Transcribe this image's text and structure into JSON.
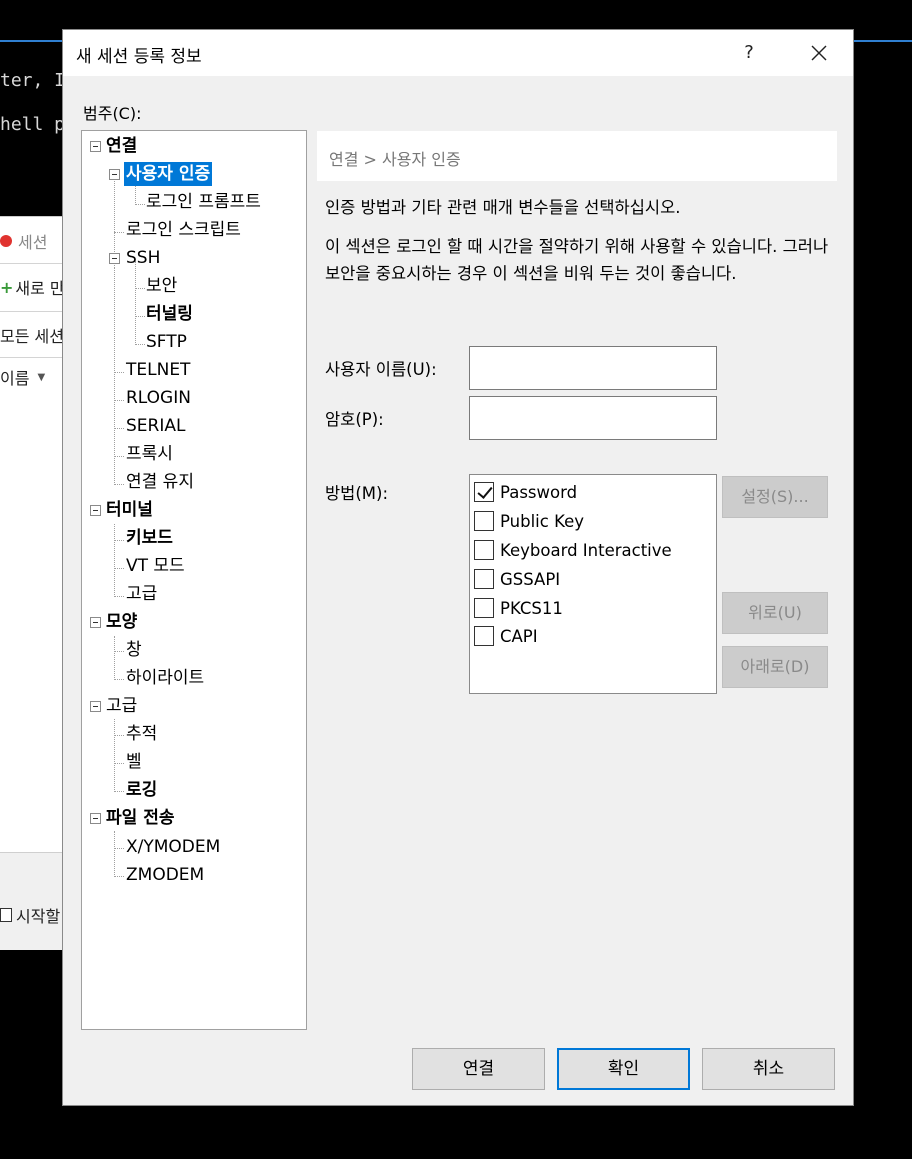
{
  "background": {
    "terminal_lines": [
      "ter, I",
      "hell p"
    ],
    "panel_items": [
      "세션",
      "새로 만",
      "모든 세션",
      "이름",
      "시작할"
    ]
  },
  "dialog": {
    "title": "새 세션 등록 정보",
    "help_label": "?",
    "category_label": "범주(C):",
    "tree": {
      "connection": "연결",
      "user_auth": "사용자 인증",
      "login_prompt": "로그인 프롬프트",
      "login_script": "로그인 스크립트",
      "ssh": "SSH",
      "security": "보안",
      "tunneling": "터널링",
      "sftp": "SFTP",
      "telnet": "TELNET",
      "rlogin": "RLOGIN",
      "serial": "SERIAL",
      "proxy": "프록시",
      "keepalive": "연결 유지",
      "terminal": "터미널",
      "keyboard": "키보드",
      "vt_mode": "VT 모드",
      "terminal_advanced": "고급",
      "appearance": "모양",
      "window": "창",
      "highlight": "하이라이트",
      "advanced": "고급",
      "trace": "추적",
      "bell": "벨",
      "logging": "로깅",
      "file_transfer": "파일 전송",
      "xymodem": "X/YMODEM",
      "zmodem": "ZMODEM"
    },
    "breadcrumb": "연결 > 사용자 인증",
    "description1": "인증 방법과 기타 관련 매개 변수들을 선택하십시오.",
    "description2": "이 섹션은 로그인 할 때 시간을 절약하기 위해 사용할 수 있습니다. 그러나 보안을 중요시하는 경우 이 섹션을 비워 두는 것이 좋습니다.",
    "username_label": "사용자 이름(U):",
    "username_value": "",
    "password_label": "암호(P):",
    "password_value": "",
    "method_label": "방법(M):",
    "methods": [
      {
        "label": "Password",
        "checked": true
      },
      {
        "label": "Public Key",
        "checked": false
      },
      {
        "label": "Keyboard Interactive",
        "checked": false
      },
      {
        "label": "GSSAPI",
        "checked": false
      },
      {
        "label": "PKCS11",
        "checked": false
      },
      {
        "label": "CAPI",
        "checked": false
      }
    ],
    "settings_button": "설정(S)...",
    "up_button": "위로(U)",
    "down_button": "아래로(D)",
    "connect_button": "연결",
    "ok_button": "확인",
    "cancel_button": "취소"
  },
  "colors": {
    "selection": "#0078d7",
    "dialog_bg": "#f0f0f0",
    "disabled_button_bg": "#cccccc"
  }
}
